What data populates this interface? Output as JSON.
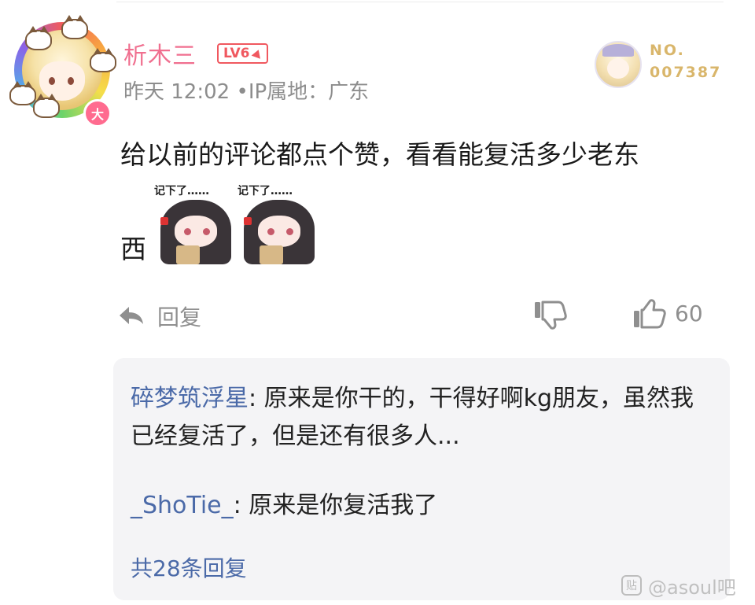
{
  "user": {
    "name": "析木三",
    "level": "LV6",
    "avatar_badge": "大",
    "time": "昨天 12:02",
    "ip": "IP属地：广东",
    "meta_separator": "•"
  },
  "fan_badge": {
    "label_line1": "NO.",
    "label_line2": "007387"
  },
  "comment": {
    "text_line1": "给以前的评论都点个赞，看看能复活多少老东",
    "text_line2": "西",
    "sticker_caption": "记下了……"
  },
  "actions": {
    "reply_label": "回复",
    "like_count": "60",
    "icons": [
      "reply-arrow-icon",
      "dislike-icon",
      "like-icon"
    ]
  },
  "replies": {
    "items": [
      {
        "user": "碎梦筑浮星",
        "text": ": 原来是你干的，干得好啊kg朋友，虽然我已经复活了，但是还有很多人..."
      },
      {
        "user": "_ShoTie_",
        "text": ": 原来是你复活我了"
      }
    ],
    "total": "共28条回复"
  },
  "watermark": {
    "icon_glyph": "贴",
    "text": "@asoul吧"
  },
  "colors": {
    "username": "#f06f8f",
    "level": "#f0585f",
    "reply_user": "#4b6aa8",
    "meta": "#8d8d8d",
    "fan_no": "#d9b66b",
    "reply_bg": "#f4f4f6"
  }
}
